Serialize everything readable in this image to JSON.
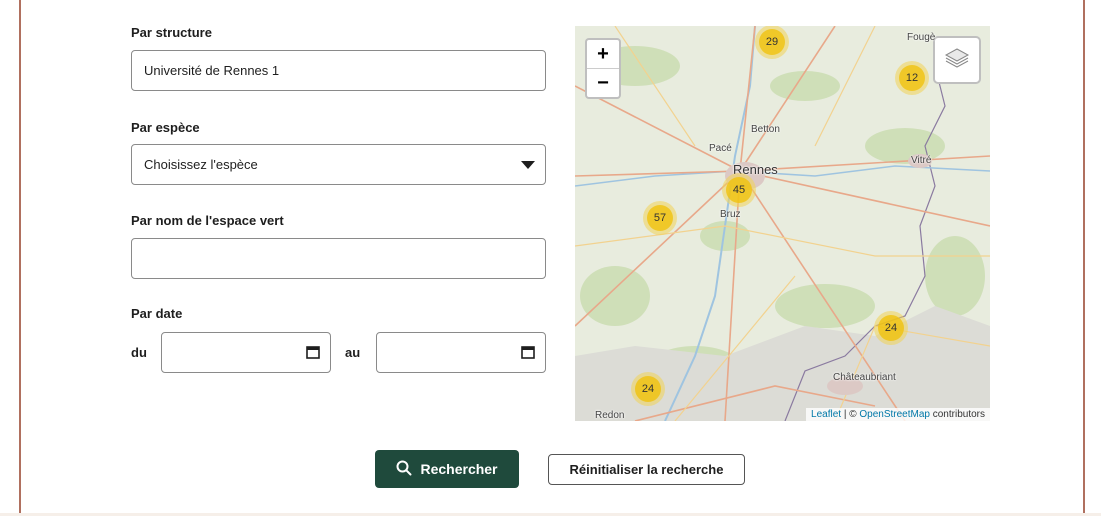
{
  "form": {
    "structure": {
      "label": "Par structure",
      "value": "Université de Rennes 1"
    },
    "species": {
      "label": "Par espèce",
      "value": "Choisissez l'espèce"
    },
    "green_space": {
      "label": "Par nom de l'espace vert",
      "value": ""
    },
    "date": {
      "label": "Par date",
      "from_label": "du",
      "to_label": "au",
      "from_value": "",
      "to_value": ""
    }
  },
  "map": {
    "zoom_in": "+",
    "zoom_out": "−",
    "places": {
      "fougeres": "Fougè",
      "betton": "Betton",
      "pace": "Pacé",
      "rennes": "Rennes",
      "vitre": "Vitré",
      "bruz": "Bruz",
      "chateaubriant": "Châteaubriant",
      "redon": "Redon"
    },
    "clusters": [
      "29",
      "12",
      "45",
      "57",
      "24",
      "24"
    ],
    "attribution": {
      "leaflet": "Leaflet",
      "sep": " | © ",
      "osm": "OpenStreetMap",
      "rest": " contributors"
    }
  },
  "actions": {
    "search": "Rechercher",
    "reset": "Réinitialiser la recherche"
  },
  "colors": {
    "frame": "#b0705f",
    "primary_button": "#1f4a3c",
    "cluster": "#f0c20c"
  }
}
